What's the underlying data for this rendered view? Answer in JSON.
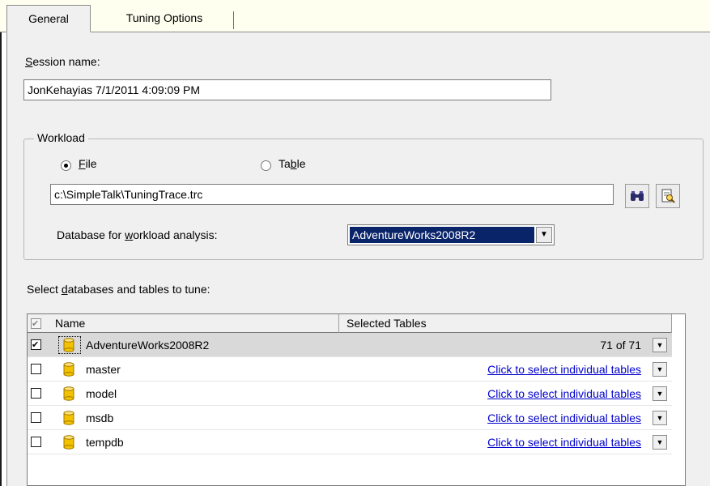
{
  "tabs": [
    {
      "label": "General",
      "active": true
    },
    {
      "label": "Tuning Options",
      "active": false
    }
  ],
  "session": {
    "label_prefix": "",
    "label_accel": "S",
    "label_rest": "ession name:",
    "value": "JonKehayias 7/1/2011 4:09:09 PM"
  },
  "workload": {
    "legend": "Workload",
    "file_label_accel": "F",
    "file_label_rest": "ile",
    "file_selected": true,
    "table_label_pre": "Ta",
    "table_label_accel": "b",
    "table_label_rest": "le",
    "table_selected": false,
    "path": "c:\\SimpleTalk\\TuningTrace.trc",
    "db_label_pre": "Database for ",
    "db_label_accel": "w",
    "db_label_rest": "orkload analysis:",
    "db_selected": "AdventureWorks2008R2",
    "icons": [
      "binoculars-icon",
      "browse-trace-icon"
    ]
  },
  "tune": {
    "label_pre": "Select ",
    "label_accel": "d",
    "label_rest": "atabases and tables to tune:",
    "columns": {
      "name": "Name",
      "tables": "Selected Tables"
    },
    "rows": [
      {
        "name": "AdventureWorks2008R2",
        "checked": true,
        "tables": "71 of 71",
        "is_link": false
      },
      {
        "name": "master",
        "checked": false,
        "tables": "Click to select individual tables",
        "is_link": true
      },
      {
        "name": "model",
        "checked": false,
        "tables": "Click to select individual tables",
        "is_link": true
      },
      {
        "name": "msdb",
        "checked": false,
        "tables": "Click to select individual tables",
        "is_link": true
      },
      {
        "name": "tempdb",
        "checked": false,
        "tables": "Click to select individual tables",
        "is_link": true
      }
    ]
  },
  "colors": {
    "link": "#0000cc",
    "selection": "#0a246a",
    "db_icon": "#f2c200",
    "tab_strip": "#fffff0"
  }
}
